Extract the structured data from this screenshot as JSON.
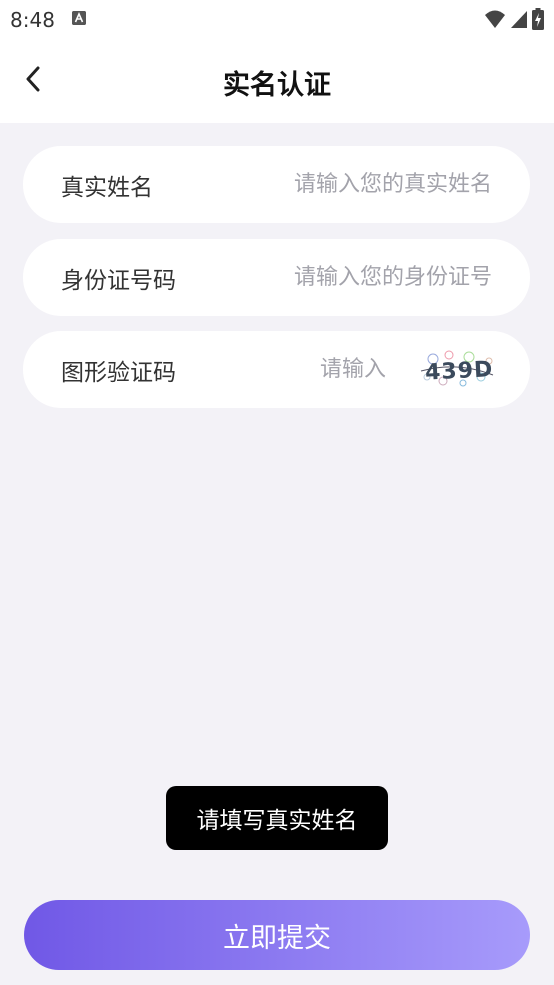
{
  "status_bar": {
    "time": "8:48",
    "notification_icon": "text-a-icon",
    "wifi_icon": "wifi-icon",
    "signal_icon": "cell-signal-icon",
    "battery_icon": "battery-charging-icon"
  },
  "header": {
    "back_icon": "chevron-left-icon",
    "title": "实名认证"
  },
  "form": {
    "real_name": {
      "label": "真实姓名",
      "placeholder": "请输入您的真实姓名",
      "value": ""
    },
    "id_number": {
      "label": "身份证号码",
      "placeholder": "请输入您的身份证号",
      "value": ""
    },
    "captcha": {
      "label": "图形验证码",
      "placeholder": "请输入",
      "value": "",
      "captcha_text": "439D"
    }
  },
  "toast": {
    "message": "请填写真实姓名"
  },
  "submit": {
    "label": "立即提交"
  },
  "colors": {
    "background": "#f3f2f7",
    "card": "#ffffff",
    "button_gradient_start": "#7058e6",
    "button_gradient_end": "#a79bfb",
    "placeholder": "#a3a3ab",
    "toast_bg": "#000000"
  }
}
